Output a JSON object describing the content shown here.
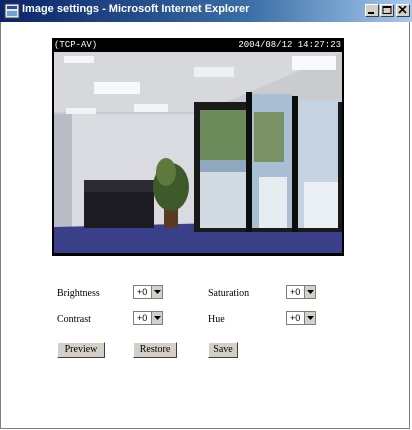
{
  "window": {
    "title": "Image settings - Microsoft Internet Explorer"
  },
  "viewer": {
    "camera_label": "(TCP-AV)",
    "timestamp": "2004/08/12 14:27:23"
  },
  "settings": {
    "brightness_label": "Brightness",
    "brightness_value": "+0",
    "saturation_label": "Saturation",
    "saturation_value": "+0",
    "contrast_label": "Contrast",
    "contrast_value": "+0",
    "hue_label": "Hue",
    "hue_value": "+0"
  },
  "buttons": {
    "preview": "Preview",
    "restore": "Restore",
    "save": "Save"
  },
  "colors": {
    "titlebar_start": "#0a246a",
    "titlebar_end": "#a6caf0",
    "button_face": "#d4d0c8"
  }
}
